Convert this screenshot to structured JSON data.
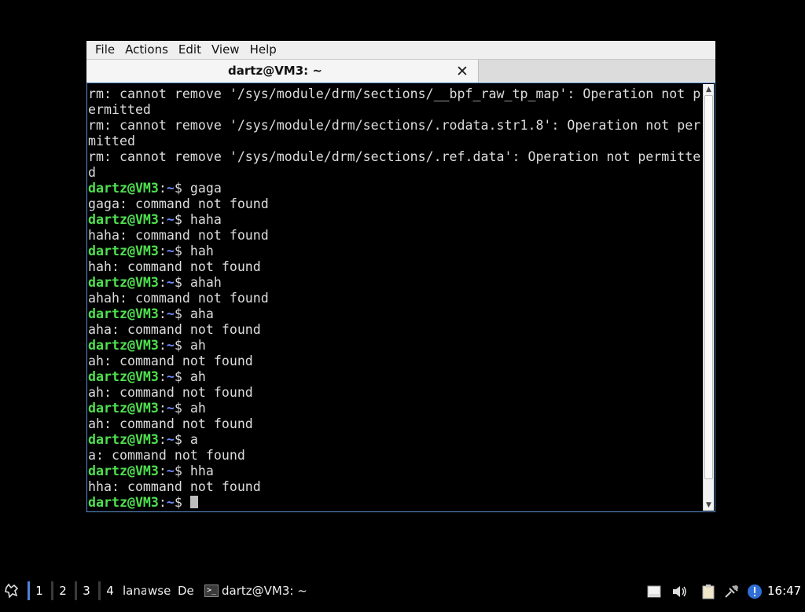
{
  "menubar": {
    "items": [
      "File",
      "Actions",
      "Edit",
      "View",
      "Help"
    ]
  },
  "tab": {
    "title": "dartz@VM3: ~",
    "close_glyph": "✕"
  },
  "terminal": {
    "prompt_user": "dartz@VM3",
    "prompt_path": "~",
    "lines": [
      {
        "type": "out",
        "text": "rm: cannot remove '/sys/module/drm/sections/__bpf_raw_tp_map': Operation not p"
      },
      {
        "type": "out",
        "text": "ermitted"
      },
      {
        "type": "out",
        "text": "rm: cannot remove '/sys/module/drm/sections/.rodata.str1.8': Operation not per"
      },
      {
        "type": "out",
        "text": "mitted"
      },
      {
        "type": "out",
        "text": "rm: cannot remove '/sys/module/drm/sections/.ref.data': Operation not permitte"
      },
      {
        "type": "out",
        "text": "d"
      },
      {
        "type": "cmd",
        "text": "gaga"
      },
      {
        "type": "out",
        "text": "gaga: command not found"
      },
      {
        "type": "cmd",
        "text": "haha"
      },
      {
        "type": "out",
        "text": "haha: command not found"
      },
      {
        "type": "cmd",
        "text": "hah"
      },
      {
        "type": "out",
        "text": "hah: command not found"
      },
      {
        "type": "cmd",
        "text": "ahah"
      },
      {
        "type": "out",
        "text": "ahah: command not found"
      },
      {
        "type": "cmd",
        "text": "aha"
      },
      {
        "type": "out",
        "text": "aha: command not found"
      },
      {
        "type": "cmd",
        "text": "ah"
      },
      {
        "type": "out",
        "text": "ah: command not found"
      },
      {
        "type": "cmd",
        "text": "ah"
      },
      {
        "type": "out",
        "text": "ah: command not found"
      },
      {
        "type": "cmd",
        "text": "ah"
      },
      {
        "type": "out",
        "text": "ah: command not found"
      },
      {
        "type": "cmd",
        "text": "a"
      },
      {
        "type": "out",
        "text": "a: command not found"
      },
      {
        "type": "cmd",
        "text": "hha"
      },
      {
        "type": "out",
        "text": "hha: command not found"
      },
      {
        "type": "prompt",
        "text": ""
      }
    ]
  },
  "taskbar": {
    "start_icon": "start-menu-icon",
    "desktops": [
      "1",
      "2",
      "3",
      "4"
    ],
    "active_desktop": "1",
    "minimized_labels": [
      "lana",
      "wse",
      "De"
    ],
    "task_title": "dartz@VM3: ~",
    "tray_icons": [
      "notes-icon",
      "volume-icon",
      "clipboard-icon",
      "network-icon",
      "update-alert-icon"
    ],
    "clock": "16:47"
  },
  "colors": {
    "prompt_green": "#4fe04f",
    "prompt_blue": "#6f8cff",
    "window_border": "#5b8fcf",
    "active_desktop": "#4a84d6"
  }
}
